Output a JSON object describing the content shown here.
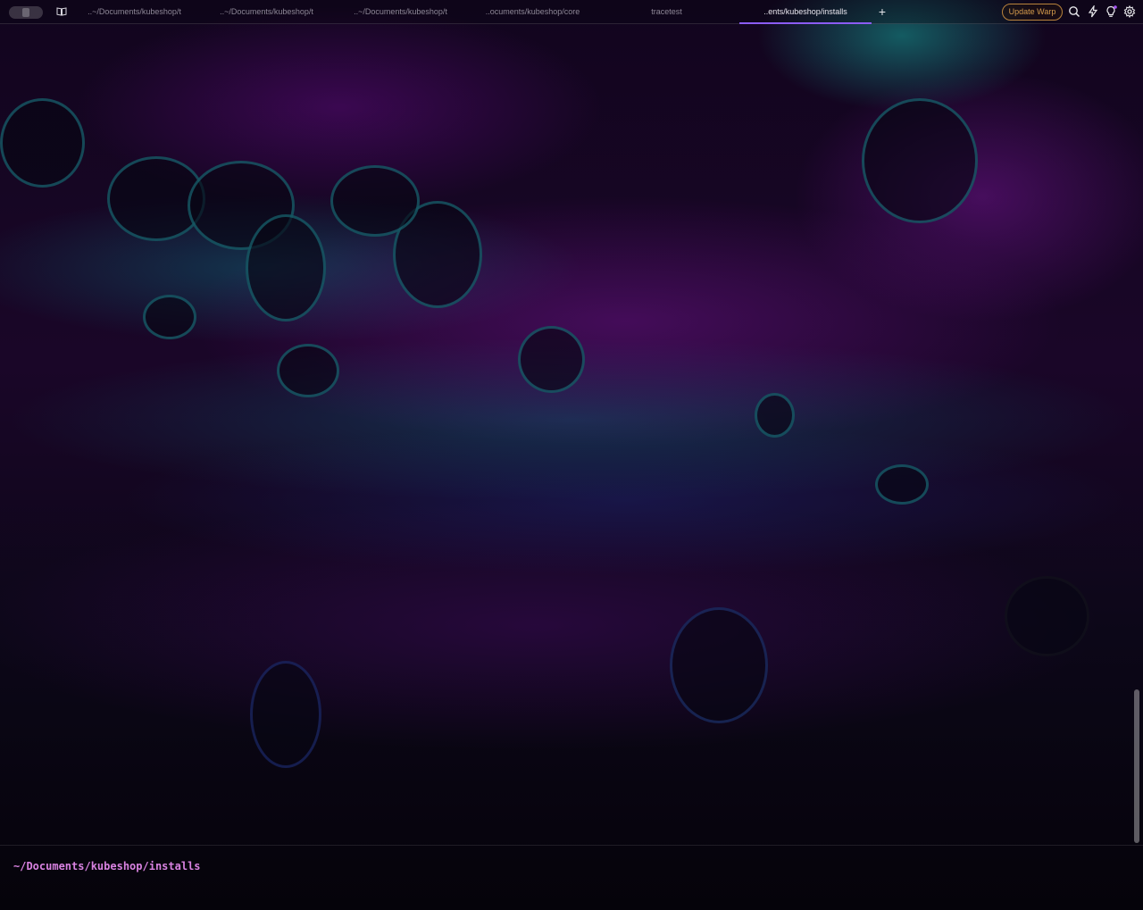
{
  "tabs": [
    {
      "label": "..~/Documents/kubeshop/t",
      "active": false
    },
    {
      "label": "..~/Documents/kubeshop/t",
      "active": false
    },
    {
      "label": "..~/Documents/kubeshop/t",
      "active": false
    },
    {
      "label": "..ocuments/kubeshop/core",
      "active": false
    },
    {
      "label": "tracetest",
      "active": false
    },
    {
      "label": "..ents/kubeshop/installs",
      "active": true
    }
  ],
  "new_tab_label": "+",
  "update_button": "Update Warp",
  "prompt": {
    "path": "~/Documents/kubeshop/installs"
  },
  "colors": {
    "accent": "#8b5cf6",
    "prompt": "#d882e0",
    "update": "#d39a4c"
  },
  "icons": {
    "toolbar": [
      "search-icon",
      "lightning-icon",
      "lightbulb-icon",
      "settings-icon"
    ],
    "left": [
      "toggle-pill-icon",
      "book-icon"
    ]
  }
}
